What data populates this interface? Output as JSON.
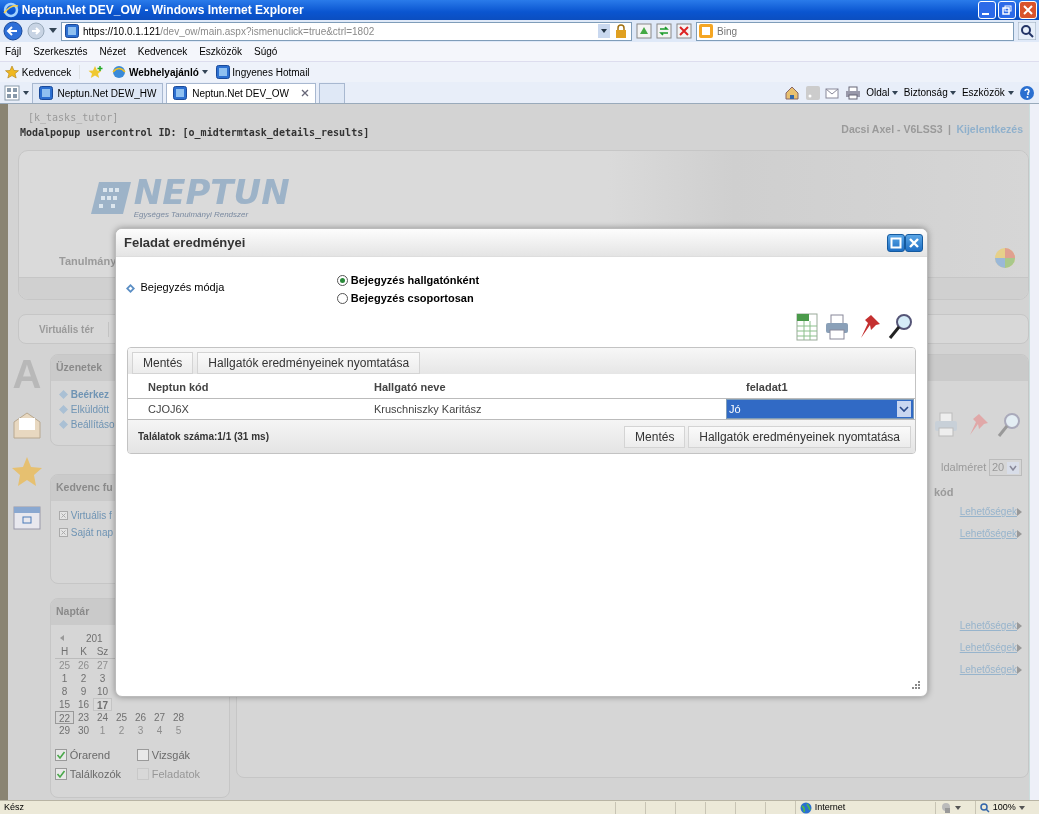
{
  "window": {
    "title": "Neptun.Net DEV_OW - Windows Internet Explorer"
  },
  "address_bar": {
    "url_host": "https://10.0.1.121",
    "url_path": "/dev_ow/main.aspx?ismenuclick=true&ctrl=1802",
    "search_placeholder": "Bing"
  },
  "menu_bar": [
    "Fájl",
    "Szerkesztés",
    "Nézet",
    "Kedvencek",
    "Eszközök",
    "Súgó"
  ],
  "favorites_bar": {
    "label": "Kedvencek",
    "items": [
      {
        "label": "Webhelyajánló",
        "bold": true,
        "dropdown": true
      },
      {
        "label": "Ingyenes Hotmail",
        "bold": false,
        "dropdown": false
      }
    ]
  },
  "browser_tabs": [
    {
      "label": "Neptun.Net DEW_HW",
      "selected": false
    },
    {
      "label": "Neptun.Net DEV_OW",
      "selected": true
    }
  ],
  "command_bar": [
    "Oldal",
    "Biztonság",
    "Eszközök"
  ],
  "page": {
    "context": "[k_tasks_tutor]",
    "control_id": "Modalpopup usercontrol ID: [o_midtermtask_details_results]",
    "user": "Dacsi Axel - V6LSS3",
    "separator": "|",
    "logout": "Kijelentkezés",
    "logo": {
      "name": "NEPTUN",
      "tagline": "Egységes Tanulmányi Rendszer"
    },
    "banner_menu": "Tanulmány",
    "nav_tab": "Virtuális tér",
    "letter_icon": "A",
    "messages": {
      "title": "Üzenetek",
      "items": [
        {
          "label": "Beérkez",
          "active": true
        },
        {
          "label": "Elküldött",
          "active": false
        },
        {
          "label": "Beállításo",
          "active": false
        }
      ]
    },
    "favorites": {
      "title": "Kedvenc fu",
      "items": [
        "Virtuális f",
        "Saját nap"
      ]
    },
    "calendar": {
      "title": "Naptár",
      "year": "201",
      "weekdays": [
        "H",
        "K",
        "Sz"
      ],
      "weeks": [
        {
          "days": [
            {
              "d": "25",
              "muted": true,
              "today": false,
              "selected": false
            },
            {
              "d": "26",
              "muted": true,
              "today": false,
              "selected": false
            },
            {
              "d": "27",
              "muted": true,
              "today": false,
              "selected": false
            }
          ]
        },
        {
          "days": [
            {
              "d": "1",
              "muted": false,
              "today": false,
              "selected": false
            },
            {
              "d": "2",
              "muted": false,
              "today": false,
              "selected": false
            },
            {
              "d": "3",
              "muted": false,
              "today": false,
              "selected": false
            }
          ]
        },
        {
          "days": [
            {
              "d": "8",
              "muted": false,
              "today": false,
              "selected": false
            },
            {
              "d": "9",
              "muted": false,
              "today": false,
              "selected": false
            },
            {
              "d": "10",
              "muted": false,
              "today": false,
              "selected": false
            }
          ]
        },
        {
          "days": [
            {
              "d": "15",
              "muted": false,
              "today": false,
              "selected": false
            },
            {
              "d": "16",
              "muted": false,
              "today": false,
              "selected": false
            },
            {
              "d": "17",
              "muted": false,
              "today": true,
              "selected": false
            }
          ]
        },
        {
          "days": [
            {
              "d": "22",
              "muted": false,
              "today": false,
              "selected": true
            },
            {
              "d": "23",
              "muted": false,
              "today": false,
              "selected": false
            },
            {
              "d": "24",
              "muted": false,
              "today": false,
              "selected": false
            },
            {
              "d": "25",
              "muted": false,
              "today": false,
              "selected": false
            },
            {
              "d": "26",
              "muted": false,
              "today": false,
              "selected": false
            },
            {
              "d": "27",
              "muted": false,
              "today": false,
              "selected": false
            },
            {
              "d": "28",
              "muted": false,
              "today": false,
              "selected": false
            }
          ]
        },
        {
          "days": [
            {
              "d": "29",
              "muted": false,
              "today": false,
              "selected": false
            },
            {
              "d": "30",
              "muted": false,
              "today": false,
              "selected": false
            },
            {
              "d": "1",
              "muted": true,
              "today": false,
              "selected": false
            },
            {
              "d": "2",
              "muted": true,
              "today": false,
              "selected": false
            },
            {
              "d": "3",
              "muted": true,
              "today": false,
              "selected": false
            },
            {
              "d": "4",
              "muted": true,
              "today": false,
              "selected": false
            },
            {
              "d": "5",
              "muted": true,
              "today": false,
              "selected": false
            }
          ]
        }
      ],
      "filters": [
        {
          "label": "Órarend",
          "checked": true,
          "disabled": false
        },
        {
          "label": "Vizsgák",
          "checked": false,
          "disabled": false
        },
        {
          "label": "Találkozók",
          "checked": true,
          "disabled": false
        },
        {
          "label": "Feladatok",
          "checked": false,
          "disabled": true
        }
      ]
    },
    "page_size_label": "ldalméret",
    "page_size": "20",
    "column_label": "kód",
    "row_links": [
      "Lehetőségek",
      "Lehetőségek",
      "Lehetőségek",
      "Lehetőségek",
      "Lehetőségek"
    ]
  },
  "modal": {
    "title": "Feladat eredményei",
    "field_label": "Bejegyzés módja",
    "radios": [
      {
        "label": "Bejegyzés hallgatónként",
        "selected": true
      },
      {
        "label": "Bejegyzés csoportosan",
        "selected": false
      }
    ],
    "buttons": [
      "Mentés",
      "Hallgatók eredményeinek nyomtatása"
    ],
    "table": {
      "columns": [
        "Neptun kód",
        "Hallgató neve",
        "feladat1"
      ],
      "rows": [
        {
          "neptun_code": "CJOJ6X",
          "name": "Kruschniszky Karitász",
          "grade": "Jó",
          "highlighted": true
        }
      ]
    },
    "footer": "Találatok száma:1/1 (31 ms)",
    "footer_buttons": [
      "Mentés",
      "Hallgatók eredményeinek nyomtatása"
    ]
  },
  "status_bar": {
    "text": "Kész",
    "zone": "Internet",
    "zoom": "100%"
  }
}
